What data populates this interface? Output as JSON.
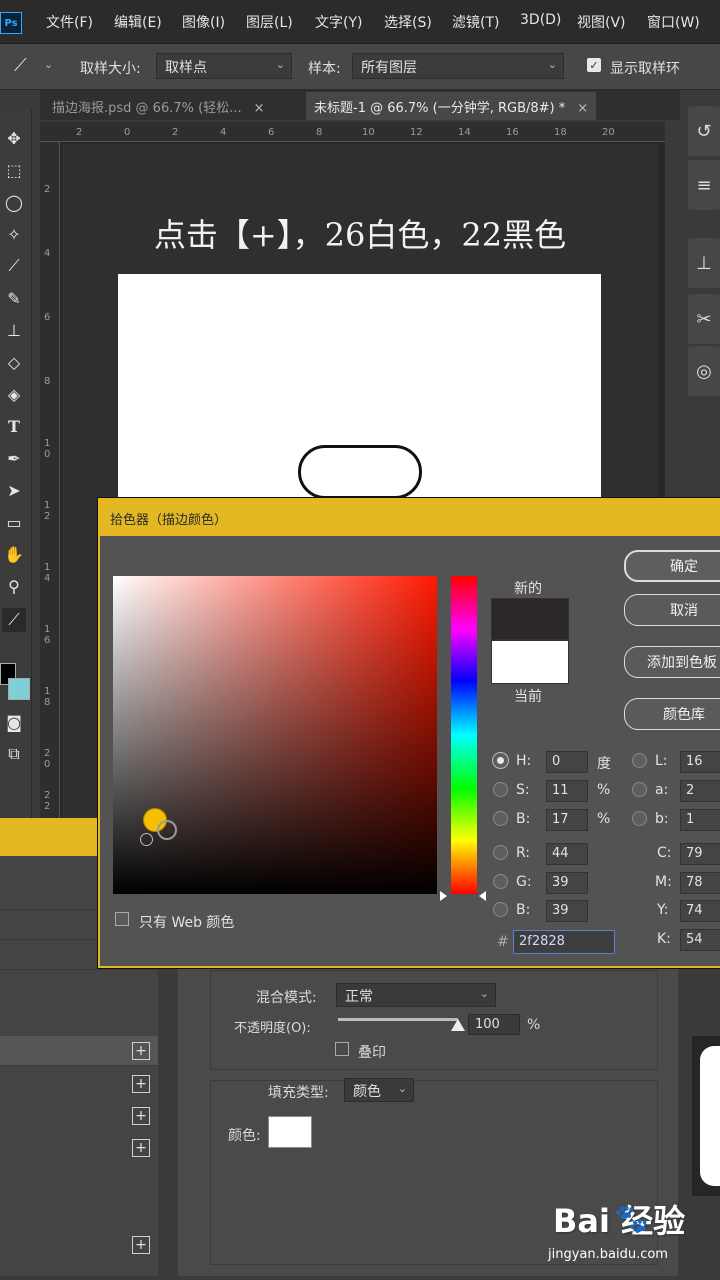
{
  "app": {
    "logo": "Ps"
  },
  "menu": [
    "文件(F)",
    "编辑(E)",
    "图像(I)",
    "图层(L)",
    "文字(Y)",
    "选择(S)",
    "滤镜(T)",
    "3D(D)",
    "视图(V)",
    "窗口(W)"
  ],
  "options": {
    "tool_icon": "eyedropper-icon",
    "sample_size_label": "取样大小:",
    "sample_size_value": "取样点",
    "sample_label": "样本:",
    "sample_value": "所有图层",
    "show_ring_label": "显示取样环",
    "show_ring_checked": true
  },
  "tabs": [
    {
      "label": "描边海报.psd @ 66.7% (轻松...",
      "active": false,
      "close": "×"
    },
    {
      "label": "未标题-1 @ 66.7% (一分钟学, RGB/8#) *",
      "active": true,
      "close": "×"
    }
  ],
  "ruler": {
    "h": [
      "2",
      "0",
      "2",
      "4",
      "6",
      "8",
      "10",
      "12",
      "14",
      "16",
      "18",
      "20"
    ],
    "v": [
      "2",
      "4",
      "6",
      "8",
      "1 0",
      "1 2",
      "1 4",
      "1 6",
      "1 8",
      "2 0",
      "2 2"
    ]
  },
  "canvas": {
    "headline": "点击【+】，26白色，22黑色",
    "bg_color": "#2f2f2f"
  },
  "tools": [
    "move-icon",
    "marquee-icon",
    "lasso-icon",
    "magic-wand-icon",
    "eyedropper-icon",
    "brush-icon",
    "stamp-icon",
    "eraser-icon",
    "paint-bucket-icon",
    "type-icon",
    "pen-icon",
    "path-select-icon",
    "rectangle-icon",
    "hand-icon",
    "zoom-icon",
    "eyedropper-icon"
  ],
  "color_picker": {
    "title": "拾色器（描边颜色）",
    "new_label": "新的",
    "current_label": "当前",
    "new_color": "#2c2728",
    "current_color": "#ffffff",
    "buttons": {
      "ok": "确定",
      "cancel": "取消",
      "add_swatch": "添加到色板",
      "libraries": "颜色库"
    },
    "hsb": {
      "h_label": "H:",
      "h": "0",
      "h_unit": "度",
      "s_label": "S:",
      "s": "11",
      "s_unit": "%",
      "b_label": "B:",
      "b": "17",
      "b_unit": "%"
    },
    "rgb": {
      "r_label": "R:",
      "r": "44",
      "g_label": "G:",
      "g": "39",
      "b_label": "B:",
      "b": "39"
    },
    "lab": {
      "l_label": "L:",
      "l": "16",
      "a_label": "a:",
      "a": "2",
      "b_label": "b:",
      "b": "1"
    },
    "cmyk": {
      "c_label": "C:",
      "c": "79",
      "m_label": "M:",
      "m": "78",
      "y_label": "Y:",
      "y": "74",
      "k_label": "K:",
      "k": "54"
    },
    "hex_label": "#",
    "hex": "2f2828",
    "web_only_label": "只有 Web 颜色",
    "accent_color": "#e4b822"
  },
  "stroke_panel": {
    "blend_label": "混合模式:",
    "blend_value": "正常",
    "opacity_label": "不透明度(O):",
    "opacity_value": "100",
    "opacity_unit": "%",
    "opacity_percent": 100,
    "overprint_label": "叠印",
    "fill_type_label": "填充类型:",
    "fill_type_value": "颜色",
    "color_label": "颜色:"
  },
  "watermark": {
    "brand": "Bai  经验",
    "url": "jingyan.baidu.com"
  }
}
